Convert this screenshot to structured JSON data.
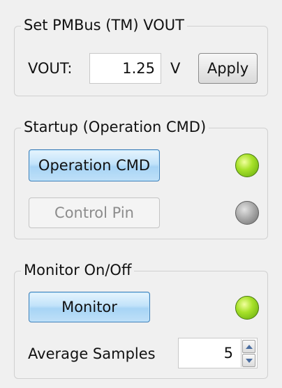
{
  "vout_group": {
    "title": "Set PMBus (TM) VOUT",
    "vout_label": "VOUT:",
    "vout_value": "1.25",
    "unit": "V",
    "apply_label": "Apply"
  },
  "startup_group": {
    "title": "Startup (Operation CMD)",
    "operation_cmd_label": "Operation CMD",
    "operation_cmd_led": "on",
    "control_pin_label": "Control Pin",
    "control_pin_led": "off"
  },
  "monitor_group": {
    "title": "Monitor On/Off",
    "monitor_label": "Monitor",
    "monitor_led": "on",
    "avg_samples_label": "Average Samples",
    "avg_samples_value": "5"
  },
  "colors": {
    "led_on": "#8fd41e",
    "led_off": "#9a9a9a",
    "blue_button": "#b3dcf7"
  }
}
